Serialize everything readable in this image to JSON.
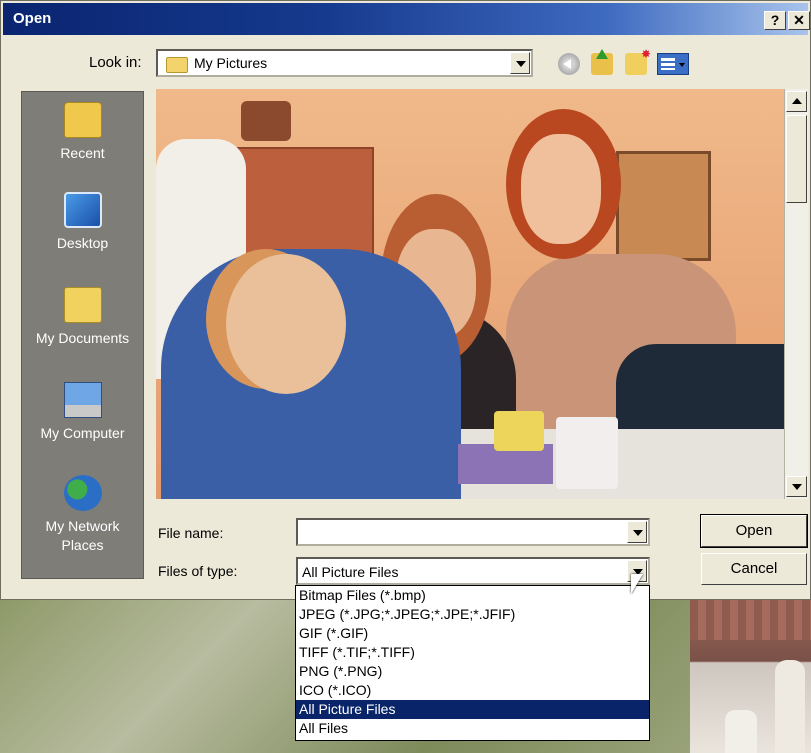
{
  "window": {
    "title": "Open",
    "help_label": "?",
    "close_label": "✕"
  },
  "toolbar": {
    "lookin_label": "Look in:",
    "lookin_value": "My Pictures",
    "icons": [
      "back-icon",
      "up-folder-icon",
      "new-folder-icon",
      "views-menu-icon"
    ]
  },
  "places": [
    {
      "label": "Recent",
      "icon": "recent-folder-icon"
    },
    {
      "label": "Desktop",
      "icon": "desktop-icon"
    },
    {
      "label": "My Documents",
      "icon": "my-documents-icon"
    },
    {
      "label": "My Computer",
      "icon": "my-computer-icon"
    },
    {
      "label": "My Network Places",
      "icon": "network-places-icon"
    }
  ],
  "form": {
    "filename_label": "File name:",
    "filename_value": "",
    "filetype_label": "Files of type:",
    "filetype_value": "All Picture Files"
  },
  "buttons": {
    "open": "Open",
    "cancel": "Cancel"
  },
  "filetype_options": [
    "Bitmap Files (*.bmp)",
    "JPEG (*.JPG;*.JPEG;*.JPE;*.JFIF)",
    "GIF (*.GIF)",
    "TIFF (*.TIF;*.TIFF)",
    "PNG (*.PNG)",
    "ICO (*.ICO)",
    "All Picture Files",
    "All Files"
  ],
  "filetype_selected_index": 6,
  "colors": {
    "titlebar": "#0a246a",
    "selection": "#0a246a",
    "dialog_bg": "#ece9d8",
    "places_bg": "#7e7d78"
  }
}
